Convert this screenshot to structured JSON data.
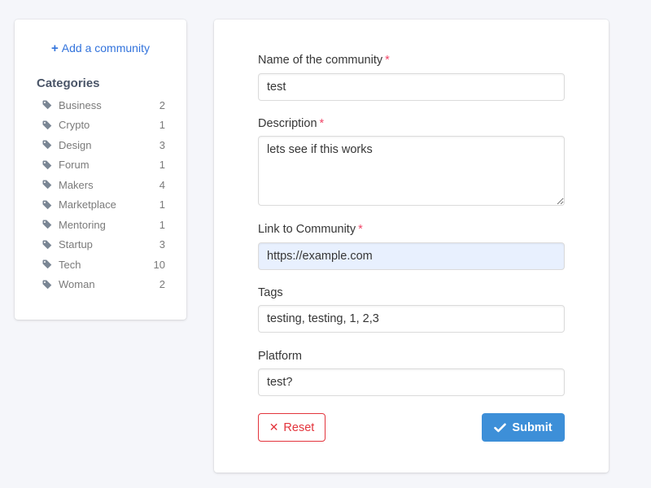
{
  "sidebar": {
    "add_community_label": "Add a community",
    "categories_title": "Categories",
    "categories": [
      {
        "label": "Business",
        "count": "2"
      },
      {
        "label": "Crypto",
        "count": "1"
      },
      {
        "label": "Design",
        "count": "3"
      },
      {
        "label": "Forum",
        "count": "1"
      },
      {
        "label": "Makers",
        "count": "4"
      },
      {
        "label": "Marketplace",
        "count": "1"
      },
      {
        "label": "Mentoring",
        "count": "1"
      },
      {
        "label": "Startup",
        "count": "3"
      },
      {
        "label": "Tech",
        "count": "10"
      },
      {
        "label": "Woman",
        "count": "2"
      }
    ]
  },
  "form": {
    "name": {
      "label": "Name of the community",
      "required_mark": "*",
      "value": "test"
    },
    "description": {
      "label": "Description",
      "required_mark": "*",
      "value": "lets see if this works"
    },
    "link": {
      "label": "Link to Community",
      "required_mark": "*",
      "value": "https://example.com"
    },
    "tags": {
      "label": "Tags",
      "value": "testing, testing, 1, 2,3"
    },
    "platform": {
      "label": "Platform",
      "value": "test?"
    },
    "reset_label": "Reset",
    "submit_label": "Submit"
  },
  "colors": {
    "accent": "#3273dc",
    "submit": "#3d8fd8",
    "danger": "#e3343c",
    "required": "#f14668",
    "autofill_bg": "#e8f0fe"
  },
  "icons": {
    "add": "plus-icon",
    "category": "tag-icon",
    "reset": "close-icon",
    "submit": "check-icon"
  }
}
